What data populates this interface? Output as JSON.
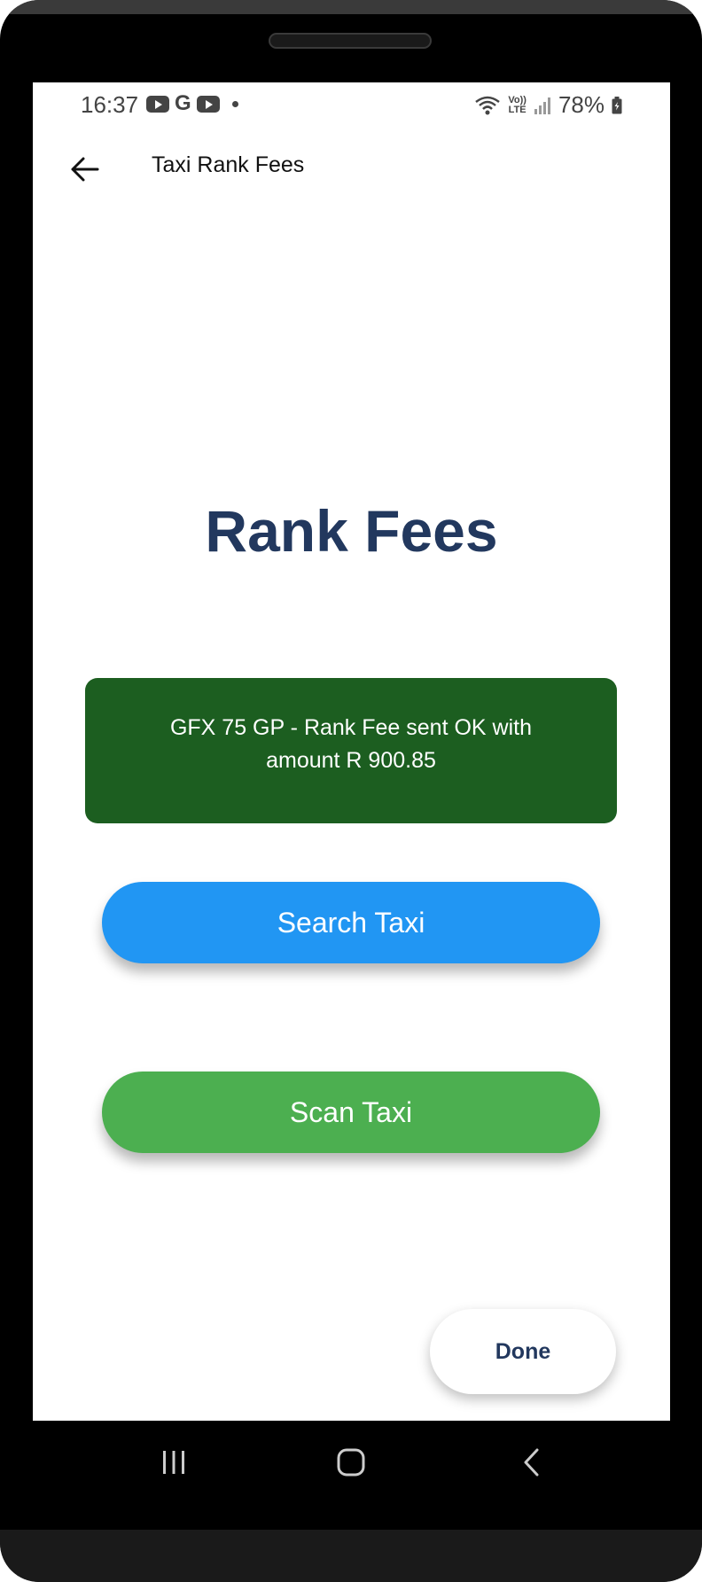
{
  "status_bar": {
    "time": "16:37",
    "battery": "78%",
    "volte_top": "Vo))",
    "volte_bottom": "LTE",
    "notification_icons": [
      "youtube-icon",
      "google-icon",
      "youtube-icon",
      "dot-icon"
    ],
    "system_icons": [
      "wifi-icon",
      "volte-icon",
      "signal-icon",
      "battery-icon"
    ]
  },
  "app_bar": {
    "title": "Taxi Rank Fees"
  },
  "main": {
    "heading": "Rank Fees",
    "message": "GFX 75 GP - Rank Fee sent OK with amount R 900.85",
    "search_button_label": "Search Taxi",
    "scan_button_label": "Scan Taxi",
    "done_button_label": "Done"
  },
  "colors": {
    "heading": "#22385e",
    "message_bg": "#1c5e20",
    "search_button": "#2196f3",
    "scan_button": "#4caf50"
  },
  "nav_bar": {
    "items": [
      "recent-apps-icon",
      "home-icon",
      "back-icon"
    ]
  }
}
